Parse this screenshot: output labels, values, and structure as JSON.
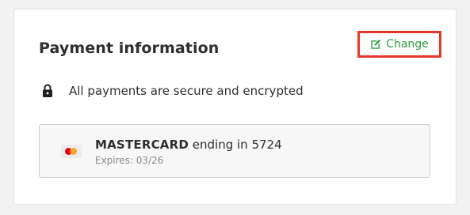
{
  "section": {
    "title": "Payment information",
    "change_label": "Change",
    "secure_text": "All payments are secure and encrypted"
  },
  "payment_method": {
    "brand": "MASTERCARD",
    "ending_text": "ending in 5724",
    "expiry": "Expires: 03/26",
    "logo_icon": "mastercard-logo"
  },
  "colors": {
    "accent_green": "#2f9a3d",
    "highlight_red": "#e8362a",
    "mastercard_red": "#eb001b",
    "mastercard_orange": "#f79e1b"
  }
}
